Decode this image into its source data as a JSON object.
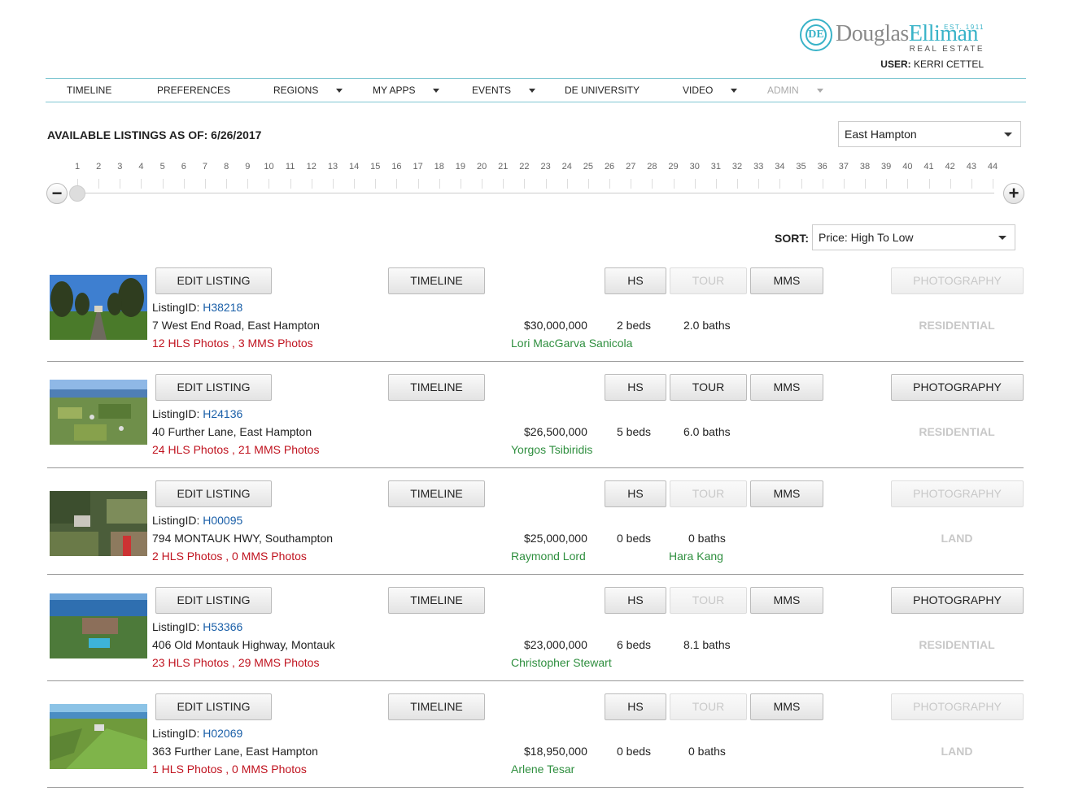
{
  "header": {
    "logo": {
      "monogram": "DE",
      "brand_part1": "Douglas",
      "brand_part2": "Elliman",
      "est": "EST. 1911",
      "tagline": "REAL ESTATE"
    },
    "user_label": "USER:",
    "user_name": "KERRI CETTEL"
  },
  "nav": {
    "items": [
      {
        "label": "TIMELINE",
        "dropdown": false,
        "disabled": false
      },
      {
        "label": "PREFERENCES",
        "dropdown": false,
        "disabled": false
      },
      {
        "label": "REGIONS",
        "dropdown": true,
        "disabled": false
      },
      {
        "label": "MY APPS",
        "dropdown": true,
        "disabled": false
      },
      {
        "label": "EVENTS",
        "dropdown": true,
        "disabled": false
      },
      {
        "label": "DE UNIVERSITY",
        "dropdown": false,
        "disabled": false
      },
      {
        "label": "VIDEO",
        "dropdown": true,
        "disabled": false
      },
      {
        "label": "ADMIN",
        "dropdown": true,
        "disabled": true
      }
    ]
  },
  "availability": {
    "label": "AVAILABLE LISTINGS AS OF: 6/26/2017",
    "region_selected": "East Hampton"
  },
  "slider": {
    "ticks": [
      "1",
      "2",
      "3",
      "4",
      "5",
      "6",
      "7",
      "8",
      "9",
      "10",
      "11",
      "12",
      "13",
      "14",
      "15",
      "16",
      "17",
      "18",
      "19",
      "20",
      "21",
      "22",
      "23",
      "24",
      "25",
      "26",
      "27",
      "28",
      "29",
      "30",
      "31",
      "32",
      "33",
      "34",
      "35",
      "36",
      "37",
      "38",
      "39",
      "40",
      "41",
      "42",
      "43",
      "44"
    ],
    "current_value": 1,
    "minus_symbol": "−",
    "plus_symbol": "+"
  },
  "sort": {
    "label": "SORT:",
    "selected": "Price: High To Low"
  },
  "buttons": {
    "edit_listing": "EDIT LISTING",
    "timeline": "TIMELINE",
    "hs": "HS",
    "tour": "TOUR",
    "mms": "MMS",
    "photography": "PHOTOGRAPHY",
    "listing_id_label": "ListingID:"
  },
  "listings": [
    {
      "id": "H38218",
      "address": "7 West End Road, East Hampton",
      "photos": "12 HLS Photos , 3 MMS Photos",
      "price": "$30,000,000",
      "beds": "2 beds",
      "baths": "2.0 baths",
      "agent": "Lori MacGarva Sanicola",
      "agent2": "",
      "type": "RESIDENTIAL",
      "tour_enabled": false,
      "photography_enabled": false,
      "thumb": "trees-lawn"
    },
    {
      "id": "H24136",
      "address": "40 Further Lane, East Hampton",
      "photos": "24 HLS Photos , 21 MMS Photos",
      "price": "$26,500,000",
      "beds": "5 beds",
      "baths": "6.0 baths",
      "agent": "Yorgos Tsibiridis",
      "agent2": "",
      "type": "RESIDENTIAL",
      "tour_enabled": true,
      "photography_enabled": true,
      "thumb": "aerial-coast"
    },
    {
      "id": "H00095",
      "address": "794 MONTAUK HWY, Southampton",
      "photos": "2 HLS Photos , 0 MMS Photos",
      "price": "$25,000,000",
      "beds": "0 beds",
      "baths": "0 baths",
      "agent": "Raymond Lord",
      "agent2": "Hara Kang",
      "type": "LAND",
      "tour_enabled": false,
      "photography_enabled": false,
      "thumb": "aerial-fields"
    },
    {
      "id": "H53366",
      "address": "406 Old Montauk Highway, Montauk",
      "photos": "23 HLS Photos , 29 MMS Photos",
      "price": "$23,000,000",
      "beds": "6 beds",
      "baths": "8.1 baths",
      "agent": "Christopher Stewart",
      "agent2": "",
      "type": "RESIDENTIAL",
      "tour_enabled": false,
      "photography_enabled": true,
      "thumb": "ocean-house"
    },
    {
      "id": "H02069",
      "address": "363 Further Lane, East Hampton",
      "photos": "1 HLS Photos , 0 MMS Photos",
      "price": "$18,950,000",
      "beds": "0 beds",
      "baths": "0 baths",
      "agent": "Arlene Tesar",
      "agent2": "",
      "type": "LAND",
      "tour_enabled": false,
      "photography_enabled": false,
      "thumb": "green-field"
    }
  ]
}
